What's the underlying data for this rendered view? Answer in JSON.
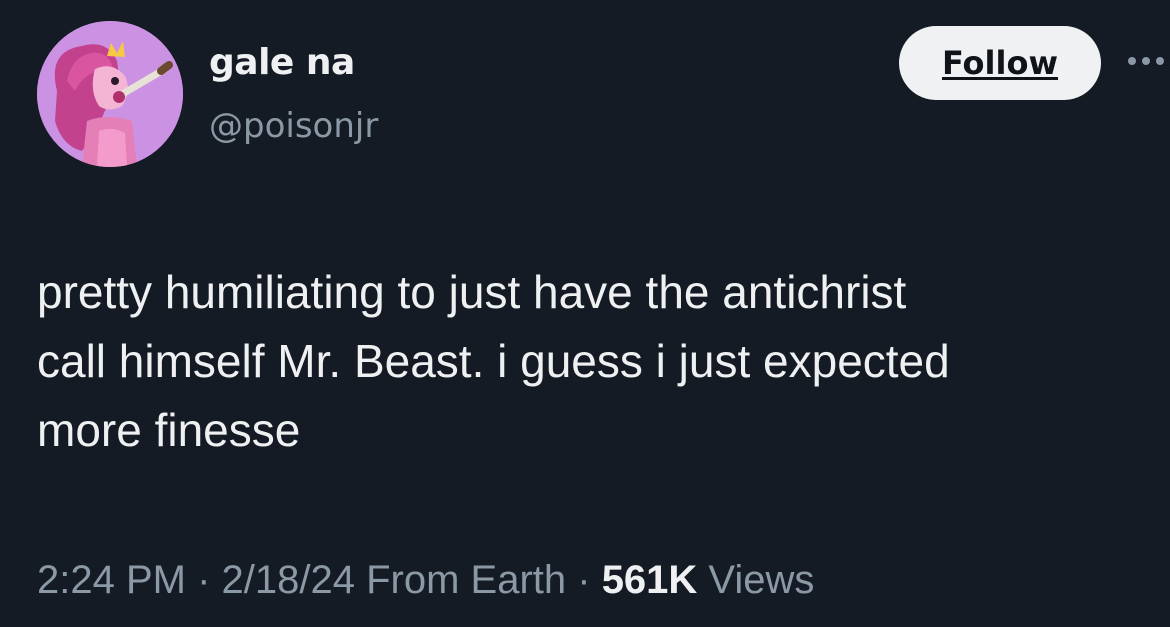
{
  "author": {
    "display_name": "gale na",
    "handle": "@poisonjr",
    "avatar_icon": "princess-bubblegum-avatar-icon"
  },
  "follow_label": "Follow",
  "more_icon": "ellipsis-icon",
  "tweet": {
    "lines": [
      "pretty humiliating to just have the antichrist",
      "call himself Mr. Beast. i guess i just expected",
      "more finesse"
    ]
  },
  "meta": {
    "time": "2:24 PM",
    "sep1": " · ",
    "date": "2/18/24",
    "source": " From Earth",
    "sep2": " · ",
    "views_count": "561K",
    "views_label": " Views"
  },
  "colors": {
    "background": "#151b24",
    "primary_text": "#eef0f1",
    "secondary_text": "#8b98a5",
    "follow_bg": "#eff1f2"
  }
}
